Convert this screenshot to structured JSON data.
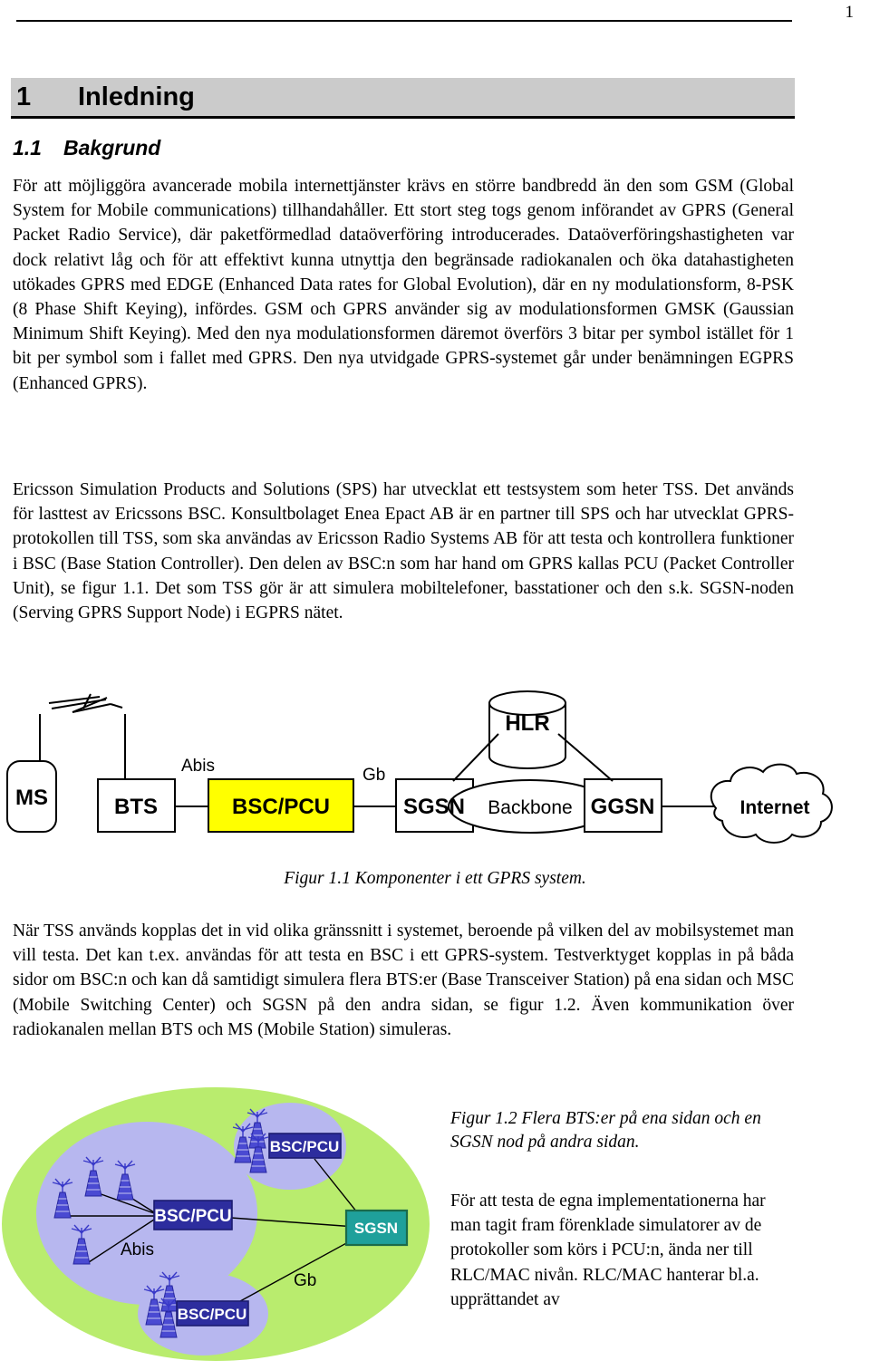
{
  "header": {
    "page_number": "1"
  },
  "headings": {
    "h1_number": "1",
    "h1_title": "Inledning",
    "h2_number": "1.1",
    "h2_title": "Bakgrund"
  },
  "body": {
    "paragraph_1": "För att möjliggöra avancerade mobila internettjänster krävs en större bandbredd än den som GSM (Global System for Mobile communications) tillhandahåller. Ett stort steg togs genom införandet av GPRS (General Packet Radio Service), där paketförmedlad dataöverföring introducerades. Dataöverföringshastigheten var dock relativt låg och för att effektivt kunna utnyttja den begränsade radiokanalen och öka datahastigheten utökades GPRS med EDGE (Enhanced Data rates for Global Evolution), där en ny modulationsform, 8-PSK (8 Phase Shift Keying), infördes. GSM och GPRS använder sig av modulationsformen GMSK (Gaussian Minimum Shift Keying). Med den nya modulationsformen däremot överförs 3 bitar per symbol istället för 1 bit per symbol som i fallet med GPRS. Den nya utvidgade GPRS-systemet går under benämningen EGPRS (Enhanced GPRS).",
    "paragraph_2": "Ericsson Simulation Products and Solutions (SPS) har utvecklat ett testsystem som heter TSS. Det används för lasttest av Ericssons BSC. Konsultbolaget Enea Epact AB är en partner till SPS och har utvecklat GPRS-protokollen till TSS, som ska användas av Ericsson Radio Systems AB för att testa och kontrollera funktioner i BSC (Base Station Controller). Den delen av BSC:n som har hand om GPRS kallas PCU (Packet Controller Unit), se figur 1.1. Det som TSS gör är att simulera mobiltelefoner, basstationer och den s.k. SGSN-noden (Serving GPRS Support Node) i EGPRS nätet.",
    "paragraph_3": "När TSS används kopplas det in vid olika gränssnitt i systemet, beroende på vilken del av mobilsystemet man vill testa. Det kan t.ex. användas för att testa en BSC i ett GPRS-system. Testverktyget kopplas in på båda sidor om BSC:n och kan då samtidigt simulera flera BTS:er (Base Transceiver Station) på ena sidan och MSC (Mobile Switching Center) och SGSN på den andra sidan, se figur 1.2. Även kommunikation över radiokanalen mellan BTS och MS (Mobile Station) simuleras.",
    "paragraph_4": "För att testa de egna implementationerna har man tagit fram förenklade simulatorer av de protokoller som körs i PCU:n, ända ner till RLC/MAC nivån. RLC/MAC hanterar bl.a. upprättandet av"
  },
  "figure_1_1": {
    "caption": "Figur 1.1 Komponenter i ett GPRS system.",
    "nodes": {
      "ms": "MS",
      "bts": "BTS",
      "bsc_pcu": "BSC/PCU",
      "sgsn": "SGSN",
      "ggsn": "GGSN",
      "hlr": "HLR",
      "backbone": "Backbone",
      "internet": "Internet"
    },
    "interface_labels": {
      "abis": "Abis",
      "gb": "Gb"
    },
    "colors": {
      "bsc_pcu_fill": "#ffff00",
      "node_fill": "#ffffff",
      "stroke": "#000000"
    }
  },
  "figure_1_2": {
    "caption": "Figur 1.2 Flera BTS:er på ena sidan och en SGSN nod på andra sidan.",
    "nodes": {
      "bsc_pcu_1": "BSC/PCU",
      "bsc_pcu_2": "BSC/PCU",
      "bsc_pcu_3": "BSC/PCU",
      "sgsn": "SGSN"
    },
    "interface_labels": {
      "abis": "Abis",
      "gb": "Gb"
    },
    "colors": {
      "outer_ellipse": "#b9ec6e",
      "inner_ellipse": "#b7b7ef",
      "bsc_pcu_fill": "#2d2d9e",
      "bsc_pcu_text": "#ffffff",
      "sgsn_fill": "#1fa09b",
      "sgsn_border": "#1b6b4a",
      "antenna": "#3939c8"
    }
  }
}
